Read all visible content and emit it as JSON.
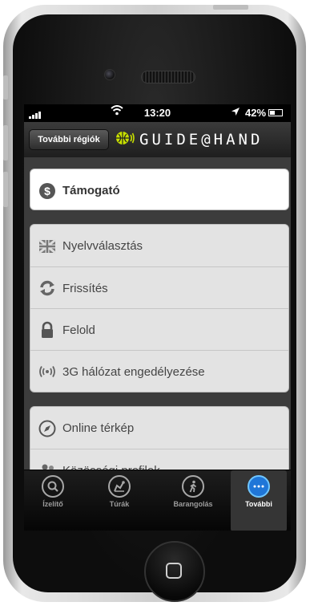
{
  "status_bar": {
    "time": "13:20",
    "battery": "42%"
  },
  "nav": {
    "back_button": "További régiók",
    "logo_text": "GUIDE@HAND"
  },
  "primary_card": {
    "label": "Támogató",
    "icon": "dollar-circle-icon"
  },
  "settings_group": [
    {
      "label": "Nyelvválasztás",
      "icon": "flag-icon"
    },
    {
      "label": "Frissítés",
      "icon": "refresh-icon"
    },
    {
      "label": "Felold",
      "icon": "lock-icon"
    },
    {
      "label": "3G hálózat engedélyezése",
      "icon": "signal-icon"
    }
  ],
  "online_group": [
    {
      "label": "Online térkép",
      "icon": "compass-icon"
    },
    {
      "label": "Közösségi profilok",
      "icon": "people-icon"
    }
  ],
  "tabs": [
    {
      "label": "Ízelítő",
      "icon": "search-icon"
    },
    {
      "label": "Túrák",
      "icon": "route-icon"
    },
    {
      "label": "Barangolás",
      "icon": "walker-icon"
    },
    {
      "label": "További",
      "icon": "more-icon"
    }
  ],
  "colors": {
    "accent": "#1f76d8",
    "tabbar": "#0a0a0a",
    "navbar": "#2a2a2a"
  }
}
